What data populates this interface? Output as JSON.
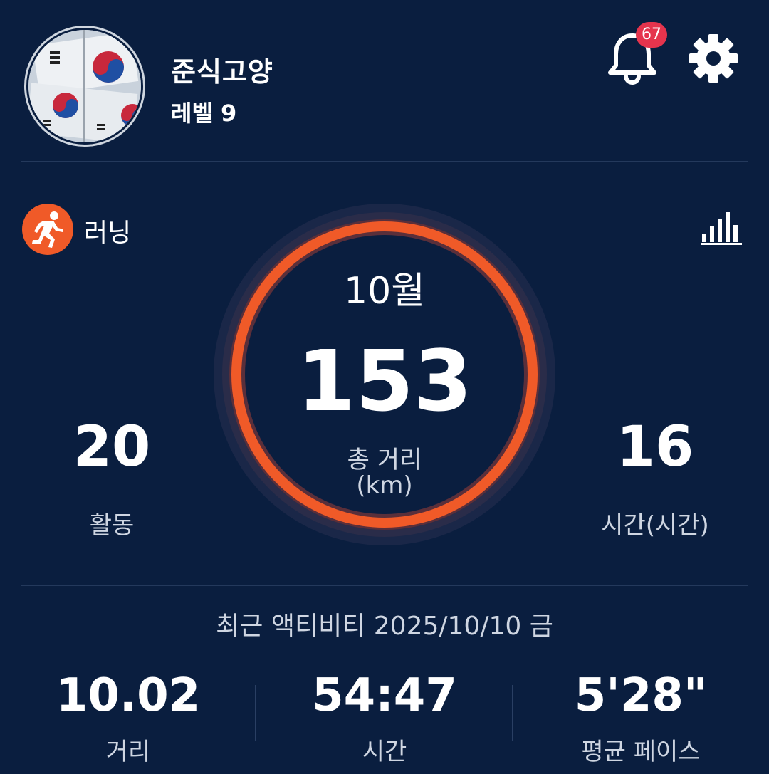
{
  "profile": {
    "name": "준식고양",
    "level": "레벨 9",
    "avatar_icon": "korean-flag-photo"
  },
  "notifications": {
    "icon": "bell-icon",
    "count": "67"
  },
  "settings": {
    "icon": "gear-icon"
  },
  "activity_type": {
    "icon": "running-icon",
    "label": "러닝",
    "color": "#f05a28",
    "stats_icon": "bar-chart-icon"
  },
  "monthly": {
    "month": "10월",
    "total_distance": "153",
    "total_label": "총 거리",
    "unit": "(km)",
    "activities_value": "20",
    "activities_label": "활동",
    "hours_value": "16",
    "hours_label": "시간(시간)"
  },
  "recent": {
    "title": "최근 액티비티 2025/10/10 금",
    "stats": [
      {
        "value": "10.02",
        "label": "거리"
      },
      {
        "value": "54:47",
        "label": "시간"
      },
      {
        "value": "5'28\"",
        "label": "평균 페이스"
      }
    ]
  },
  "colors": {
    "background": "#0a1e3f",
    "accent": "#f05a28",
    "badge": "#e5344d"
  }
}
